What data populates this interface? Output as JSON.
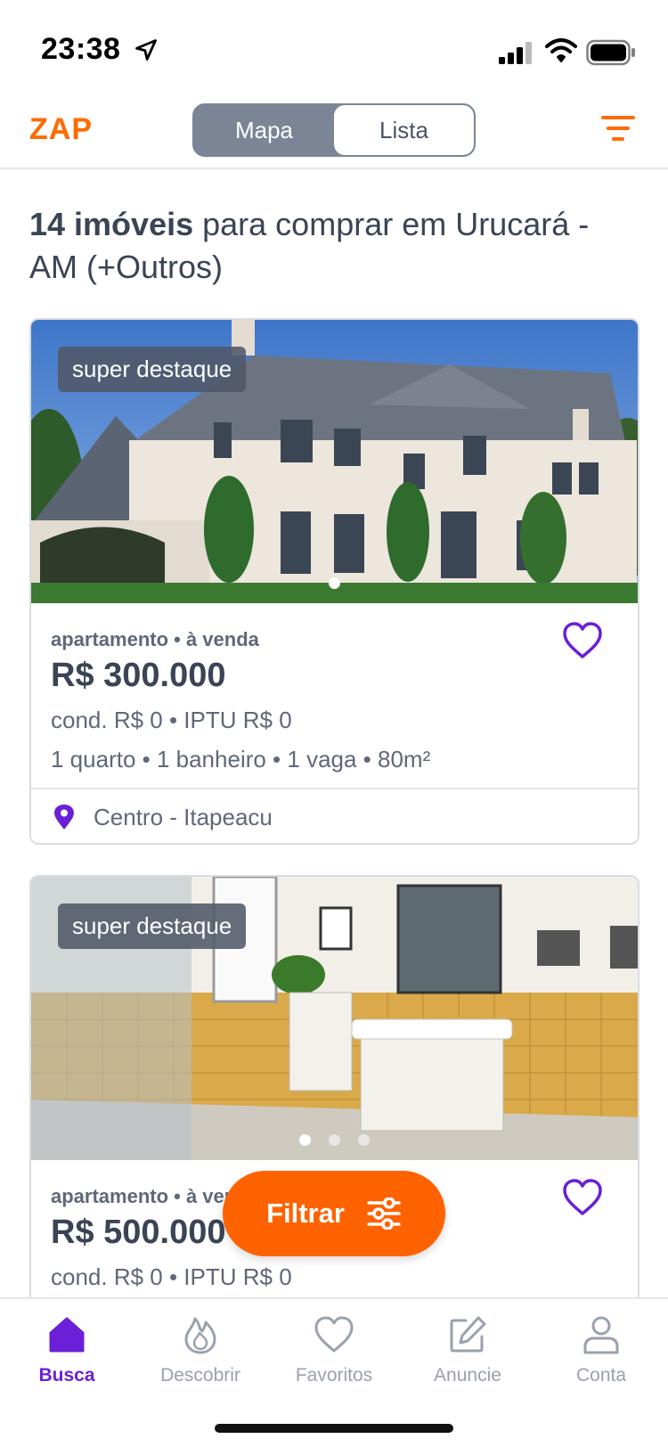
{
  "status_bar": {
    "time": "23:38"
  },
  "header": {
    "logo": "ZAP",
    "toggle": {
      "map_label": "Mapa",
      "list_label": "Lista",
      "active": "Mapa"
    }
  },
  "results": {
    "count_text": "14 imóveis",
    "rest_text": " para comprar em Urucará - AM (+Outros)"
  },
  "listings": [
    {
      "badge": "super destaque",
      "type": "apartamento • à venda",
      "price": "R$ 300.000",
      "fees": "cond. R$ 0 • IPTU R$ 0",
      "features": "1 quarto • 1 banheiro • 1 vaga • 80m²",
      "location": "Centro - Itapeacu",
      "photo_dots": 1,
      "photo_active": 0
    },
    {
      "badge": "super destaque",
      "type": "apartamento • à venda",
      "price": "R$ 500.000",
      "fees": "cond. R$ 0 • IPTU R$ 0",
      "photo_dots": 3,
      "photo_active": 0
    }
  ],
  "fab": {
    "label": "Filtrar"
  },
  "tabs": [
    {
      "label": "Busca",
      "icon": "home-icon",
      "active": true
    },
    {
      "label": "Descobrir",
      "icon": "flame-icon",
      "active": false
    },
    {
      "label": "Favoritos",
      "icon": "heart-icon",
      "active": false
    },
    {
      "label": "Anuncie",
      "icon": "edit-icon",
      "active": false
    },
    {
      "label": "Conta",
      "icon": "user-icon",
      "active": false
    }
  ],
  "colors": {
    "brand": "#ff6a00",
    "accent": "#6b1fd6",
    "text": "#3b4455",
    "muted": "#9aa1ad"
  }
}
